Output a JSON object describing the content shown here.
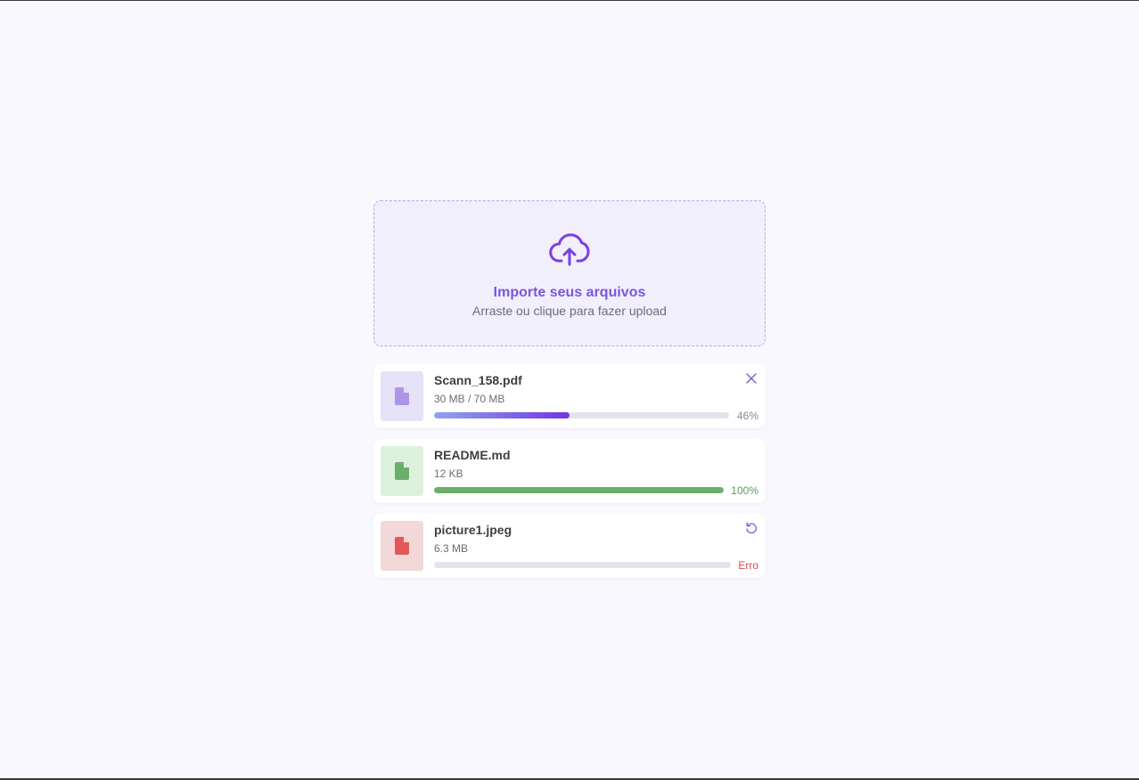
{
  "upload": {
    "title": "Importe seus arquivos",
    "subtitle": "Arraste ou clique para fazer upload",
    "icon": "cloud-upload-icon"
  },
  "colors": {
    "accent": "#7b57e0",
    "background": "#f9f8fe",
    "dropzone_bg": "#f1effc",
    "success": "#6aaf6a",
    "error": "#d94a4a",
    "track": "#e4e2ec"
  },
  "files": [
    {
      "name": "Scann_158.pdf",
      "size": "30 MB / 70 MB",
      "status": "46%",
      "progress": 0.46,
      "state": "uploading",
      "action_icon": "close-icon"
    },
    {
      "name": "README.md",
      "size": "12 KB",
      "status": "100%",
      "progress": 1.0,
      "state": "done"
    },
    {
      "name": "picture1.jpeg",
      "size": "6.3 MB",
      "status": "Erro",
      "progress": 0,
      "state": "error",
      "action_icon": "retry-icon"
    }
  ]
}
